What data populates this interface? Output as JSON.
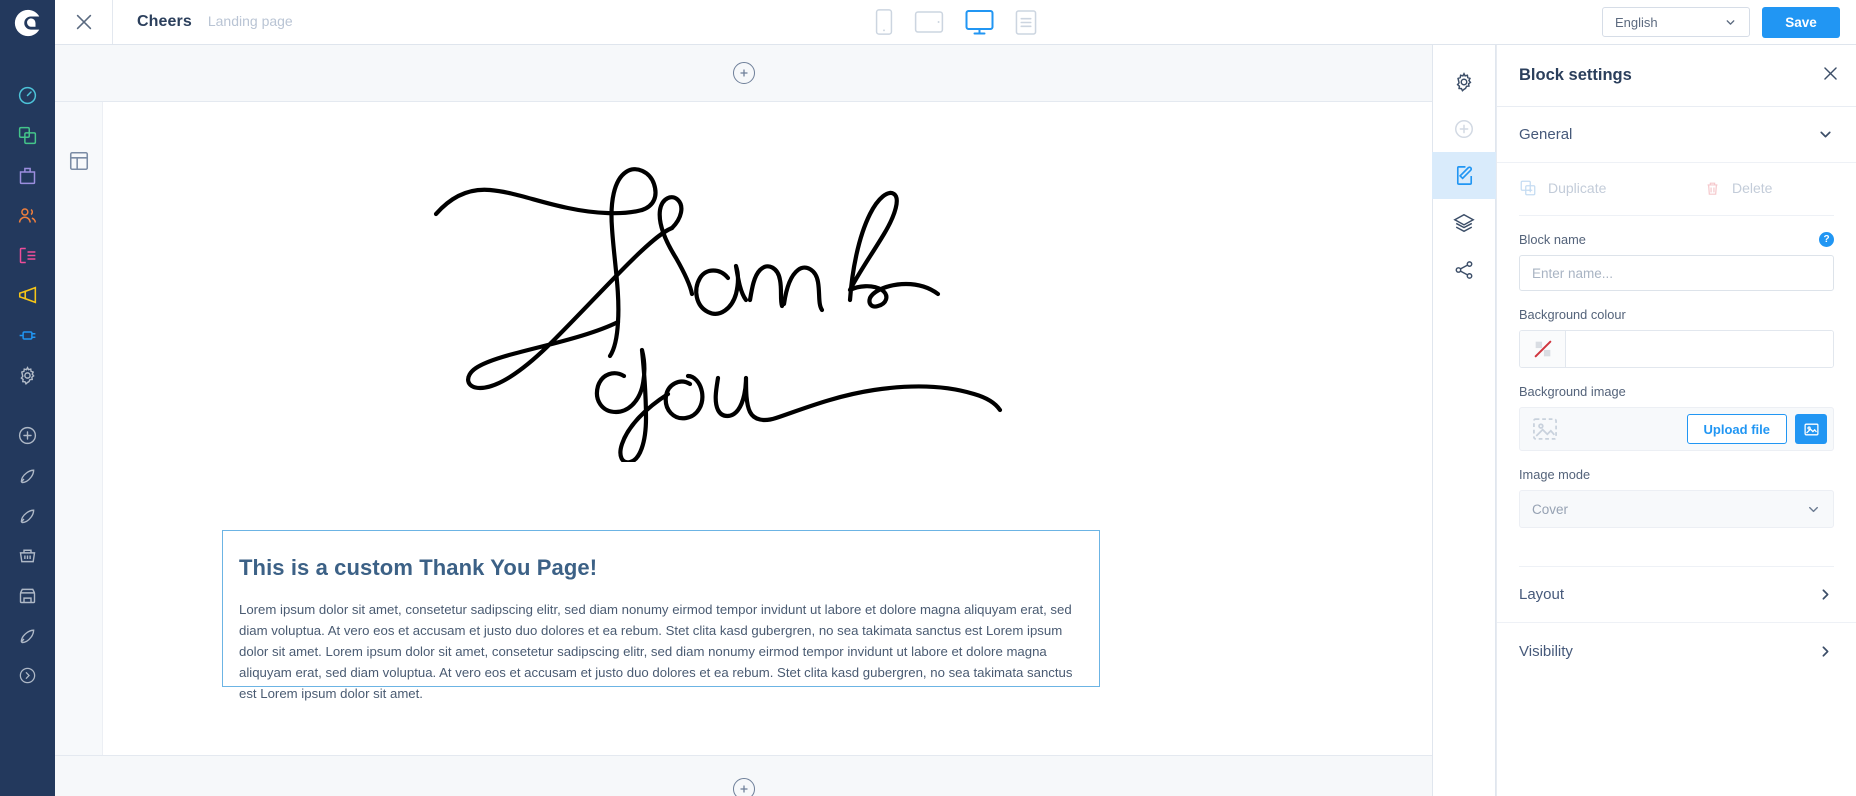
{
  "brand": {
    "accent": "#2196f3",
    "navy": "#23395d"
  },
  "leftnav": {
    "logo": "sendinblue-logo-icon",
    "items": [
      {
        "name": "dashboard-icon",
        "color": "#4dc3d8"
      },
      {
        "name": "campaigns-icon",
        "color": "#44c58a"
      },
      {
        "name": "templates-icon",
        "color": "#9b8ede"
      },
      {
        "name": "contacts-icon",
        "color": "#f07f3c"
      },
      {
        "name": "forms-icon",
        "color": "#ef4d9a"
      },
      {
        "name": "marketing-megaphone-icon",
        "color": "#f5c518"
      },
      {
        "name": "plugins-icon",
        "color": "#2196f3"
      },
      {
        "name": "settings-gear-icon",
        "color": "#aeb8c6"
      },
      {
        "name": "add-circle-icon",
        "color": "#aeb8c6"
      },
      {
        "name": "automation-rocket-icon",
        "color": "#aeb8c6"
      },
      {
        "name": "transactional-rocket-icon",
        "color": "#aeb8c6"
      },
      {
        "name": "inbox-basket-icon",
        "color": "#aeb8c6"
      },
      {
        "name": "store-icon",
        "color": "#aeb8c6"
      },
      {
        "name": "launch-rocket-icon",
        "color": "#aeb8c6"
      },
      {
        "name": "expand-chevron-icon",
        "color": "#aeb8c6"
      }
    ]
  },
  "topbar": {
    "close_icon": "close-icon",
    "title": "Cheers",
    "subtitle": "Landing page",
    "devices": [
      {
        "name": "mobile-view-icon",
        "label": "Mobile",
        "active": false
      },
      {
        "name": "tablet-view-icon",
        "label": "Tablet",
        "active": false
      },
      {
        "name": "desktop-view-icon",
        "label": "Desktop",
        "active": true
      },
      {
        "name": "text-view-icon",
        "label": "Text",
        "active": false
      }
    ],
    "language": {
      "value": "English",
      "chevron": "chevron-down-icon"
    },
    "save_label": "Save"
  },
  "canvas": {
    "add_block_top_icon": "plus-circle-icon",
    "add_block_bottom_icon": "plus-circle-icon",
    "gutter_icon": "layout-template-icon",
    "signature_alt": "Thank you handwritten signature",
    "block": {
      "heading": "This is a custom Thank You Page!",
      "paragraph": "Lorem ipsum dolor sit amet, consetetur sadipscing elitr, sed diam nonumy eirmod tempor invidunt ut labore et dolore magna aliquyam erat, sed diam voluptua. At vero eos et accusam et justo duo dolores et ea rebum. Stet clita kasd gubergren, no sea takimata sanctus est Lorem ipsum dolor sit amet. Lorem ipsum dolor sit amet, consetetur sadipscing elitr, sed diam nonumy eirmod tempor invidunt ut labore et dolore magna aliquyam erat, sed diam voluptua. At vero eos et accusam et justo duo dolores et ea rebum. Stet clita kasd gubergren, no sea takimata sanctus est Lorem ipsum dolor sit amet."
    }
  },
  "iconrail": {
    "items": [
      {
        "name": "page-settings-gear-icon",
        "active": false,
        "disabled": false
      },
      {
        "name": "add-block-circle-icon",
        "active": false,
        "disabled": true
      },
      {
        "name": "edit-block-icon",
        "active": true,
        "disabled": false
      },
      {
        "name": "layers-icon",
        "active": false,
        "disabled": false
      },
      {
        "name": "share-icon",
        "active": false,
        "disabled": false
      }
    ]
  },
  "panel": {
    "title": "Block settings",
    "close_icon": "close-icon",
    "sections": {
      "general": {
        "label": "General",
        "chevron": "chevron-down-icon",
        "expanded": true
      },
      "layout": {
        "label": "Layout",
        "chevron": "chevron-right-icon",
        "expanded": false
      },
      "visibility": {
        "label": "Visibility",
        "chevron": "chevron-right-icon",
        "expanded": false
      }
    },
    "duplicate": {
      "label": "Duplicate",
      "icon": "duplicate-icon"
    },
    "delete": {
      "label": "Delete",
      "icon": "trash-icon"
    },
    "block_name": {
      "label": "Block name",
      "value": "",
      "placeholder": "Enter name...",
      "help_badge": "?"
    },
    "background_colour": {
      "label": "Background colour",
      "swatch_icon": "no-colour-icon",
      "value": ""
    },
    "background_image": {
      "label": "Background image",
      "thumb_icon": "image-placeholder-icon",
      "upload_label": "Upload file",
      "gallery_icon": "image-gallery-icon"
    },
    "image_mode": {
      "label": "Image mode",
      "value": "Cover",
      "chevron": "chevron-down-icon"
    }
  }
}
